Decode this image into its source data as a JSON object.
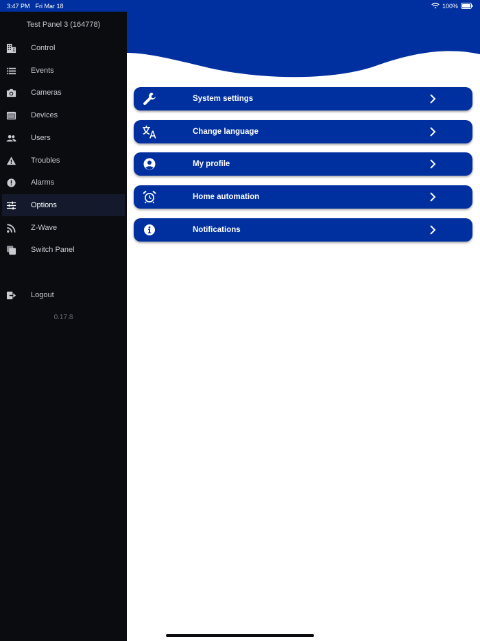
{
  "status_bar": {
    "time": "3:47 PM",
    "date": "Fri Mar 18",
    "battery": "100%",
    "icons": [
      "wifi-icon",
      "battery-icon"
    ]
  },
  "sidebar": {
    "title": "Test Panel 3 (164778)",
    "items": [
      {
        "label": "Control",
        "icon": "building-icon"
      },
      {
        "label": "Events",
        "icon": "list-icon"
      },
      {
        "label": "Cameras",
        "icon": "camera-icon"
      },
      {
        "label": "Devices",
        "icon": "device-icon"
      },
      {
        "label": "Users",
        "icon": "users-icon"
      },
      {
        "label": "Troubles",
        "icon": "warning-icon"
      },
      {
        "label": "Alarms",
        "icon": "alert-circle-icon"
      },
      {
        "label": "Options",
        "icon": "sliders-icon",
        "active": true
      },
      {
        "label": "Z-Wave",
        "icon": "rss-icon"
      },
      {
        "label": "Switch Panel",
        "icon": "switch-panel-icon"
      }
    ],
    "logout": {
      "label": "Logout",
      "icon": "logout-icon"
    },
    "version": "0.17.8"
  },
  "options": [
    {
      "label": "System settings",
      "icon": "wrench-icon"
    },
    {
      "label": "Change language",
      "icon": "translate-icon"
    },
    {
      "label": "My profile",
      "icon": "user-circle-icon"
    },
    {
      "label": "Home automation",
      "icon": "alarm-clock-icon"
    },
    {
      "label": "Notifications",
      "icon": "info-icon"
    }
  ],
  "colors": {
    "brand_blue": "#00309f",
    "sidebar_bg": "#0b0c10",
    "active_item_bg": "#141a2b"
  }
}
